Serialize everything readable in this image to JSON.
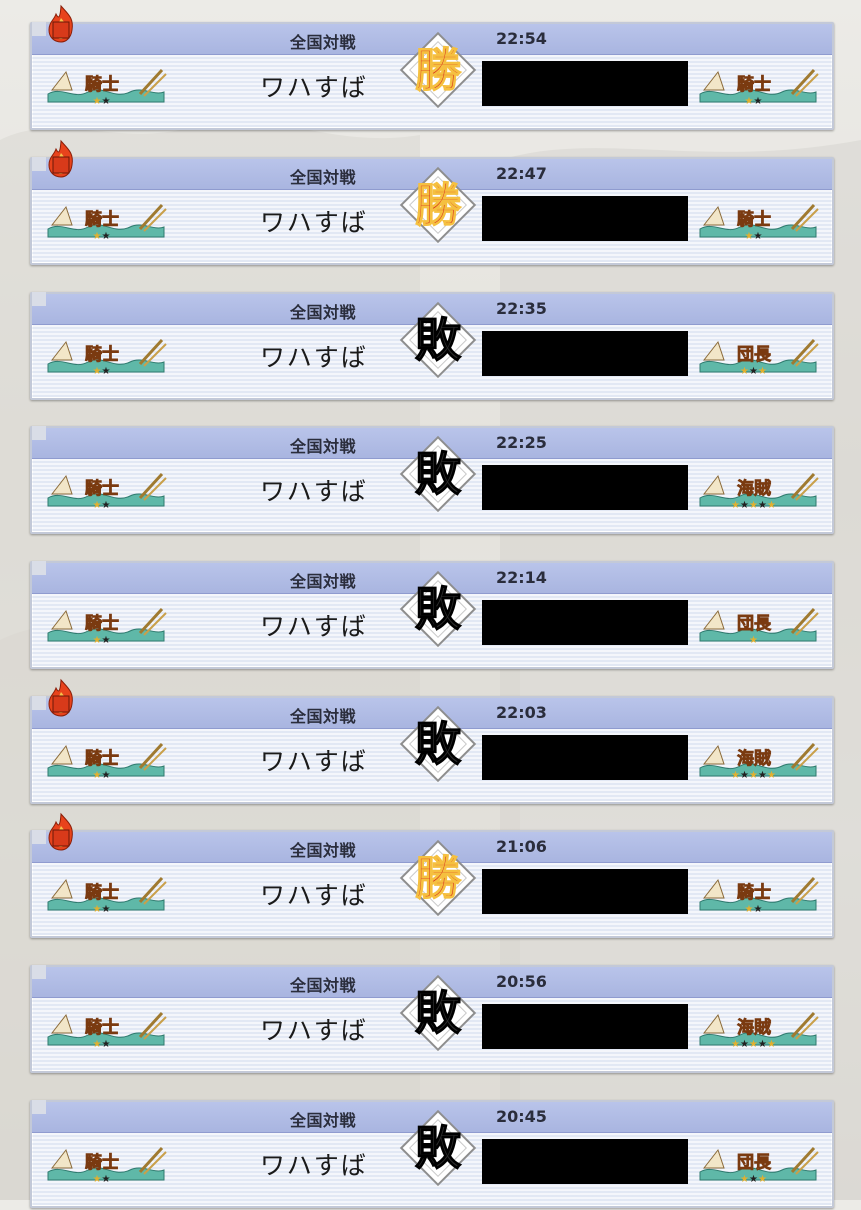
{
  "colors": {
    "header": "#b0bce4",
    "card": "#e7ecf6",
    "win": "#d62a1c",
    "loss": "#2a2a2a",
    "redaction": "#000000"
  },
  "matches": [
    {
      "mode": "全国対戦",
      "time": "22:54",
      "player": "ワハすば",
      "result": "勝",
      "result_type": "win",
      "flame": true,
      "player_rank": "騎士",
      "opponent_rank": "騎士",
      "opponent_stars": 2
    },
    {
      "mode": "全国対戦",
      "time": "22:47",
      "player": "ワハすば",
      "result": "勝",
      "result_type": "win",
      "flame": true,
      "player_rank": "騎士",
      "opponent_rank": "騎士",
      "opponent_stars": 2
    },
    {
      "mode": "全国対戦",
      "time": "22:35",
      "player": "ワハすば",
      "result": "敗",
      "result_type": "loss",
      "flame": false,
      "player_rank": "騎士",
      "opponent_rank": "団長",
      "opponent_stars": 3
    },
    {
      "mode": "全国対戦",
      "time": "22:25",
      "player": "ワハすば",
      "result": "敗",
      "result_type": "loss",
      "flame": false,
      "player_rank": "騎士",
      "opponent_rank": "海賊",
      "opponent_stars": 5
    },
    {
      "mode": "全国対戦",
      "time": "22:14",
      "player": "ワハすば",
      "result": "敗",
      "result_type": "loss",
      "flame": false,
      "player_rank": "騎士",
      "opponent_rank": "団長",
      "opponent_stars": 1
    },
    {
      "mode": "全国対戦",
      "time": "22:03",
      "player": "ワハすば",
      "result": "敗",
      "result_type": "loss",
      "flame": true,
      "player_rank": "騎士",
      "opponent_rank": "海賊",
      "opponent_stars": 5
    },
    {
      "mode": "全国対戦",
      "time": "21:06",
      "player": "ワハすば",
      "result": "勝",
      "result_type": "win",
      "flame": true,
      "player_rank": "騎士",
      "opponent_rank": "騎士",
      "opponent_stars": 2
    },
    {
      "mode": "全国対戦",
      "time": "20:56",
      "player": "ワハすば",
      "result": "敗",
      "result_type": "loss",
      "flame": false,
      "player_rank": "騎士",
      "opponent_rank": "海賊",
      "opponent_stars": 5
    },
    {
      "mode": "全国対戦",
      "time": "20:45",
      "player": "ワハすば",
      "result": "敗",
      "result_type": "loss",
      "flame": false,
      "player_rank": "騎士",
      "opponent_rank": "団長",
      "opponent_stars": 3
    }
  ]
}
